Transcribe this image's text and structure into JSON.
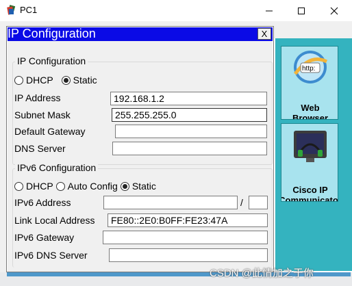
{
  "window": {
    "title": "PC1"
  },
  "dialog": {
    "title": "IP Configuration",
    "close_label": "X",
    "ipv4": {
      "legend": "IP Configuration",
      "dhcp_label": "DHCP",
      "static_label": "Static",
      "selected_mode": "Static",
      "ip_address_label": "IP Address",
      "ip_address_value": "192.168.1.2",
      "subnet_mask_label": "Subnet Mask",
      "subnet_mask_value": "255.255.255.0",
      "gateway_label": "Default Gateway",
      "gateway_value": "",
      "dns_label": "DNS Server",
      "dns_value": ""
    },
    "ipv6": {
      "legend": "IPv6 Configuration",
      "dhcp_label": "DHCP",
      "auto_label": "Auto Config",
      "static_label": "Static",
      "selected_mode": "Static",
      "address_label": "IPv6 Address",
      "address_value": "",
      "prefix_separator": "/",
      "prefix_value": "",
      "link_local_label": "Link Local Address",
      "link_local_value": "FE80::2E0:B0FF:FE23:47A",
      "gateway_label": "IPv6 Gateway",
      "gateway_value": "",
      "dns_label": "IPv6 DNS Server",
      "dns_value": ""
    }
  },
  "apps": [
    {
      "label_line1": "Web",
      "label_line2": "Browser",
      "icon": "web-browser-icon"
    },
    {
      "label_line1": "Cisco IP",
      "label_line2": "Communicator",
      "icon": "cisco-ip-communicator-icon"
    }
  ],
  "watermark": "CSDN @此情加之于你",
  "colors": {
    "dialog_header": "#0a0ae6",
    "desktop_teal": "#34b3bf",
    "tile_bg": "#a8e3ee"
  }
}
